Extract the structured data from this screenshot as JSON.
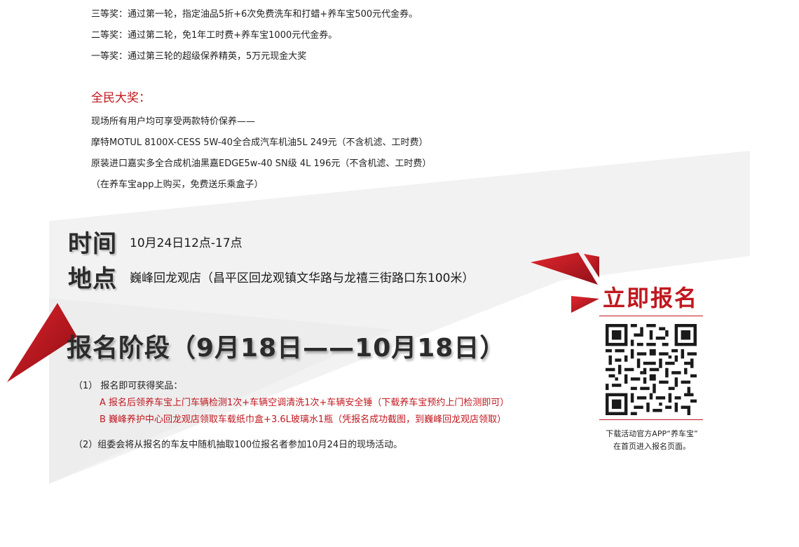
{
  "prizes": {
    "third": "三等奖：通过第一轮，指定油品5折+6次免费洗车和打蜡+养车宝500元代金券。",
    "second": "二等奖：通过第二轮，免1年工时费+养车宝1000元代金券。",
    "first": "一等奖：通过第三轮的超级保养精英，5万元现金大奖"
  },
  "public_prize": {
    "title": "全民大奖：",
    "lines": [
      "现场所有用户均可享受两款特价保养——",
      "摩特MOTUL 8100X-CESS 5W-40全合成汽车机油5L  249元（不含机滤、工时费）",
      "原装进口嘉实多全合成机油黑嘉EDGE5w-40 SN级 4L 196元（不含机滤、工时费）",
      "（在养车宝app上购买，免费送乐乘盒子）"
    ]
  },
  "event": {
    "time_label": "时间",
    "time_value": "10月24日12点-17点",
    "place_label": "地点",
    "place_value": "巍峰回龙观店（昌平区回龙观镇文华路与龙禧三街路口东100米）"
  },
  "registration": {
    "title": "报名阶段（9月18日——10月18日）",
    "step1": "（1） 报名即可获得奖品：",
    "reward_a": "A 报名后领养车宝上门车辆检测1次+车辆空调清洗1次+车辆安全锤（下载养车宝预约上门检测即可）",
    "reward_b": "B 巍峰养护中心回龙观店领取车载纸巾盒+3.6L玻璃水1瓶（凭报名成功截图，到巍峰回龙观店领取）",
    "step2": "（2）组委会将从报名的车友中随机抽取100位报名者参加10月24日的现场活动。"
  },
  "signup": {
    "title": "立即报名",
    "caption_line1": "下载活动官方APP“养车宝”",
    "caption_line2": "在首页进入报名页面。"
  },
  "colors": {
    "accent_red": "#c0181f",
    "band_gray": "#f1f1f1"
  }
}
